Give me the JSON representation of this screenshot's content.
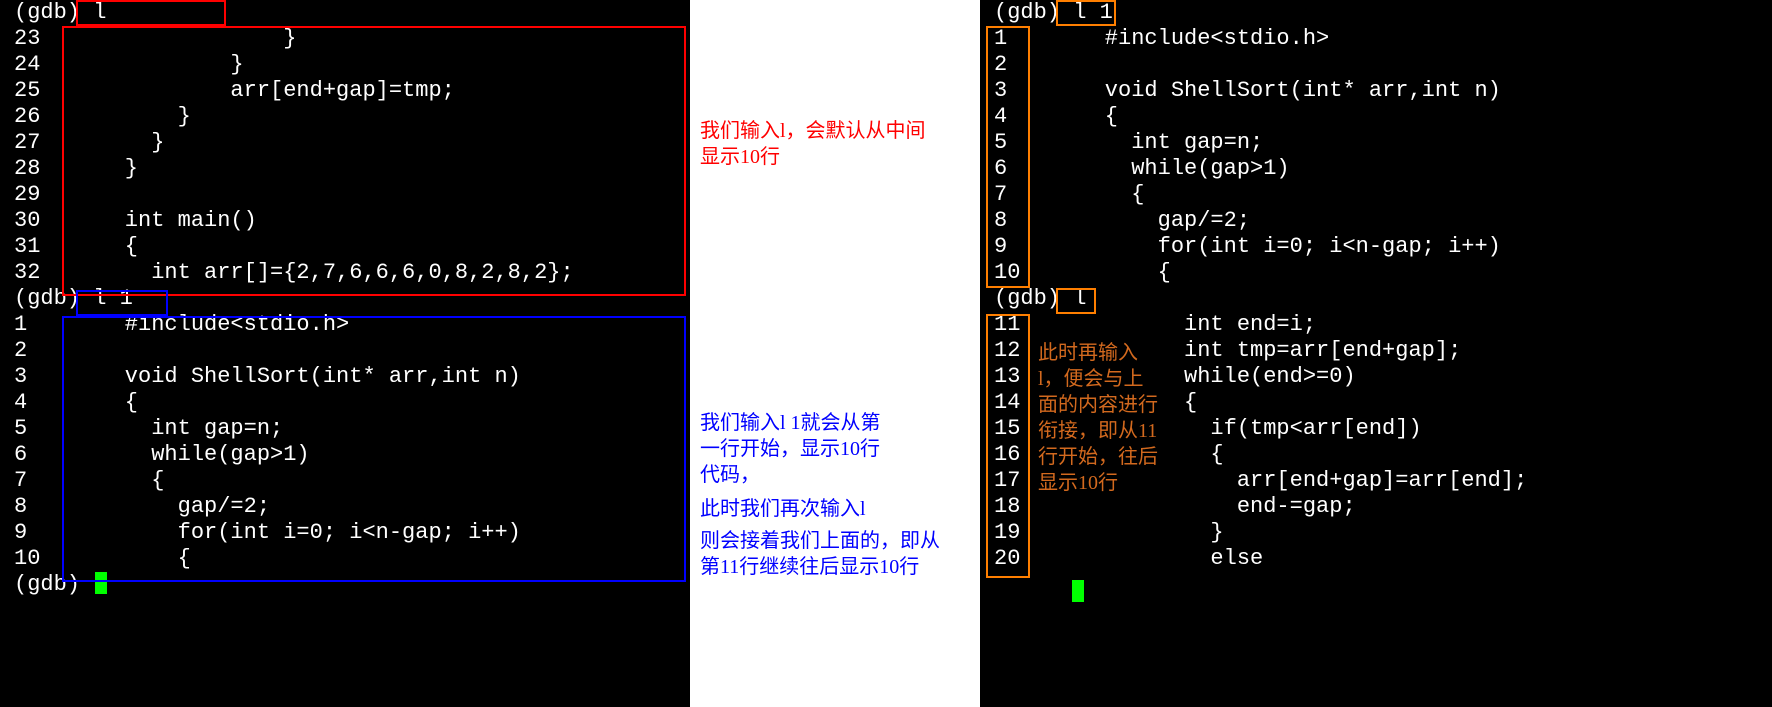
{
  "left": {
    "prompt1": "(gdb) l",
    "block1": [
      {
        "n": "23",
        "c": "                }"
      },
      {
        "n": "24",
        "c": "            }"
      },
      {
        "n": "25",
        "c": "            arr[end+gap]=tmp;"
      },
      {
        "n": "26",
        "c": "        }"
      },
      {
        "n": "27",
        "c": "      }"
      },
      {
        "n": "28",
        "c": "    }"
      },
      {
        "n": "29",
        "c": ""
      },
      {
        "n": "30",
        "c": "    int main()"
      },
      {
        "n": "31",
        "c": "    {"
      },
      {
        "n": "32",
        "c": "      int arr[]={2,7,6,6,6,0,8,2,8,2};"
      }
    ],
    "prompt2": "(gdb) l 1",
    "block2": [
      {
        "n": "1",
        "c": "    #include<stdio.h>"
      },
      {
        "n": "2",
        "c": ""
      },
      {
        "n": "3",
        "c": "    void ShellSort(int* arr,int n)"
      },
      {
        "n": "4",
        "c": "    {"
      },
      {
        "n": "5",
        "c": "      int gap=n;"
      },
      {
        "n": "6",
        "c": "      while(gap>1)"
      },
      {
        "n": "7",
        "c": "      {"
      },
      {
        "n": "8",
        "c": "        gap/=2;"
      },
      {
        "n": "9",
        "c": "        for(int i=0; i<n-gap; i++)"
      },
      {
        "n": "10",
        "c": "        {"
      }
    ],
    "prompt3": "(gdb) "
  },
  "right": {
    "prompt1": "(gdb) l 1",
    "block1": [
      {
        "n": "1",
        "c": "    #include<stdio.h>"
      },
      {
        "n": "2",
        "c": ""
      },
      {
        "n": "3",
        "c": "    void ShellSort(int* arr,int n)"
      },
      {
        "n": "4",
        "c": "    {"
      },
      {
        "n": "5",
        "c": "      int gap=n;"
      },
      {
        "n": "6",
        "c": "      while(gap>1)"
      },
      {
        "n": "7",
        "c": "      {"
      },
      {
        "n": "8",
        "c": "        gap/=2;"
      },
      {
        "n": "9",
        "c": "        for(int i=0; i<n-gap; i++)"
      },
      {
        "n": "10",
        "c": "        {"
      }
    ],
    "prompt2": "(gdb) l",
    "block2": [
      {
        "n": "11",
        "c": "          int end=i;"
      },
      {
        "n": "12",
        "c": "          int tmp=arr[end+gap];"
      },
      {
        "n": "13",
        "c": "          while(end>=0)"
      },
      {
        "n": "14",
        "c": "          {"
      },
      {
        "n": "15",
        "c": "            if(tmp<arr[end])"
      },
      {
        "n": "16",
        "c": "            {"
      },
      {
        "n": "17",
        "c": "              arr[end+gap]=arr[end];"
      },
      {
        "n": "18",
        "c": "              end-=gap;"
      },
      {
        "n": "19",
        "c": "            }"
      },
      {
        "n": "20",
        "c": "            else"
      }
    ]
  },
  "annotations": {
    "mid_red_1": "我们输入l，会默认从中间",
    "mid_red_2": "显示10行",
    "mid_blue_1": "我们输入l 1就会从第",
    "mid_blue_2": "一行开始，显示10行",
    "mid_blue_3": "代码，",
    "mid_blue_4": "此时我们再次输入l",
    "mid_blue_5": "则会接着我们上面的，即从",
    "mid_blue_6": "第11行继续往后显示10行",
    "right_orange_1": "此时再输入",
    "right_orange_2": "l，便会与上",
    "right_orange_3": "面的内容进行",
    "right_orange_4": "衔接，即从11",
    "right_orange_5": "行开始，往后",
    "right_orange_6": "显示10行"
  }
}
